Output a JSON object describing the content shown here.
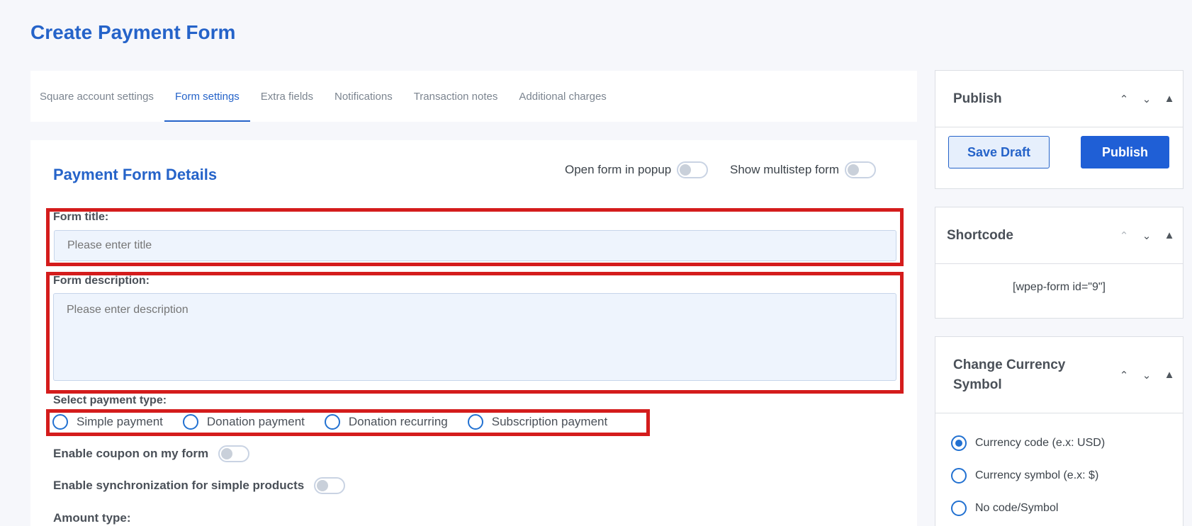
{
  "page": {
    "title": "Create Payment Form"
  },
  "tabs": [
    {
      "label": "Square account settings"
    },
    {
      "label": "Form settings",
      "active": true
    },
    {
      "label": "Extra fields"
    },
    {
      "label": "Notifications"
    },
    {
      "label": "Transaction notes"
    },
    {
      "label": "Additional charges"
    }
  ],
  "main": {
    "section_title": "Payment Form Details",
    "toggles": {
      "popup_label": "Open form in popup",
      "multistep_label": "Show multistep form"
    },
    "form_title": {
      "label": "Form title:",
      "placeholder": "Please enter title"
    },
    "form_description": {
      "label": "Form description:",
      "placeholder": "Please enter description"
    },
    "payment_type": {
      "label": "Select payment type:",
      "options": [
        "Simple payment",
        "Donation payment",
        "Donation recurring",
        "Subscription payment"
      ]
    },
    "coupon_label": "Enable coupon on my form",
    "sync_label": "Enable synchronization for simple products",
    "amount_type_label": "Amount type:"
  },
  "sidebar": {
    "publish": {
      "title": "Publish",
      "save_draft": "Save Draft",
      "publish_button": "Publish"
    },
    "shortcode": {
      "title": "Shortcode",
      "value": "[wpep-form id=\"9\"]"
    },
    "currency": {
      "title_line1": "Change Currency",
      "title_line2": "Symbol",
      "options": [
        "Currency code (e.x: USD)",
        "Currency symbol (e.x: $)",
        "No code/Symbol"
      ],
      "selected_index": 0
    }
  },
  "colors": {
    "accent": "#2563c9",
    "highlight": "#d41c1c",
    "input_bg": "#eef4fd"
  },
  "icons": {
    "up": "chevron-up-icon",
    "down": "chevron-down-icon",
    "collapse": "triangle-up-icon"
  }
}
